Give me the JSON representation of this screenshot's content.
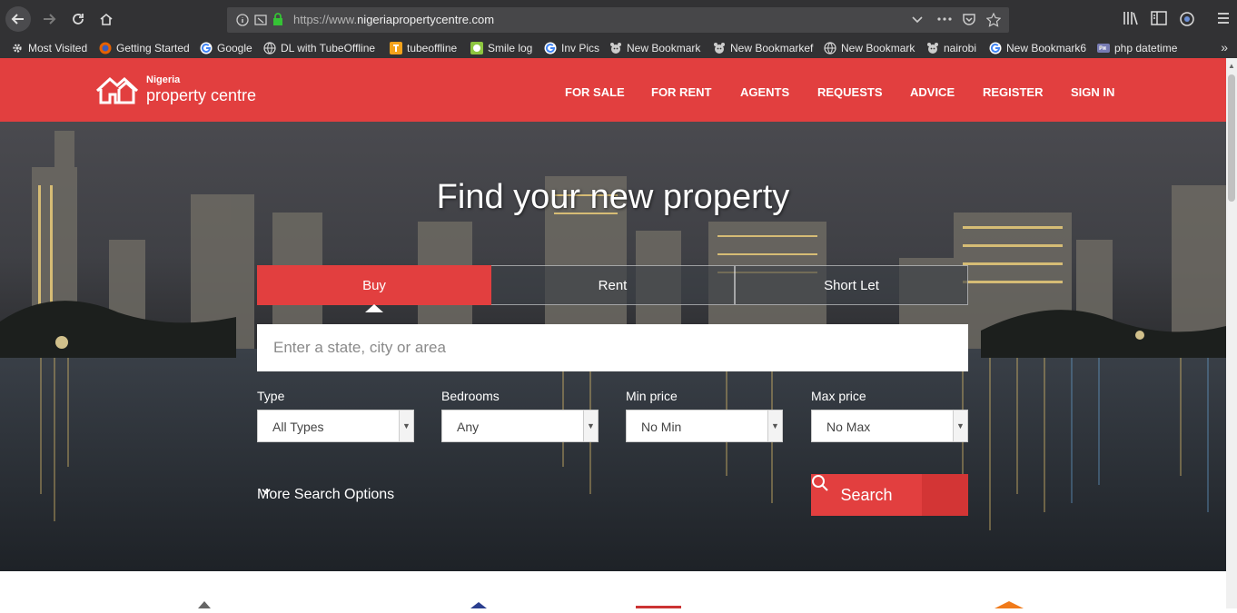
{
  "browser": {
    "url_prefix": "https://www.",
    "url_domain": "nigeriapropertycentre.com",
    "bookmarks": [
      {
        "label": "Most Visited",
        "icon": "gear-icon"
      },
      {
        "label": "Getting Started",
        "icon": "firefox-icon"
      },
      {
        "label": "Google",
        "icon": "google-icon"
      },
      {
        "label": "DL with TubeOffline",
        "icon": "globe-icon"
      },
      {
        "label": "tubeoffline",
        "icon": "tubeoffline-icon"
      },
      {
        "label": "Smile log",
        "icon": "smile-icon"
      },
      {
        "label": "Inv Pics",
        "icon": "google-icon"
      },
      {
        "label": "New Bookmark",
        "icon": "bear-icon"
      },
      {
        "label": "New Bookmarkef",
        "icon": "bear-icon"
      },
      {
        "label": "New Bookmark",
        "icon": "globe-icon"
      },
      {
        "label": "nairobi",
        "icon": "bear-icon"
      },
      {
        "label": "New Bookmark6",
        "icon": "google-icon"
      },
      {
        "label": "php datetime",
        "icon": "php-icon"
      }
    ]
  },
  "site": {
    "logo_small": "Nigeria",
    "logo_big": "property centre",
    "nav": [
      "FOR SALE",
      "FOR RENT",
      "AGENTS",
      "REQUESTS",
      "ADVICE",
      "REGISTER",
      "SIGN IN"
    ],
    "brand_color": "#e23f3f"
  },
  "hero": {
    "title": "Find your new property",
    "tabs": [
      "Buy",
      "Rent",
      "Short Let"
    ],
    "active_tab": "Buy",
    "search_placeholder": "Enter a state, city or area",
    "filters": [
      {
        "label": "Type",
        "value": "All Types"
      },
      {
        "label": "Bedrooms",
        "value": "Any"
      },
      {
        "label": "Min price",
        "value": "No Min"
      },
      {
        "label": "Max price",
        "value": "No Max"
      }
    ],
    "more_options": "More Search Options",
    "search_button": "Search"
  }
}
